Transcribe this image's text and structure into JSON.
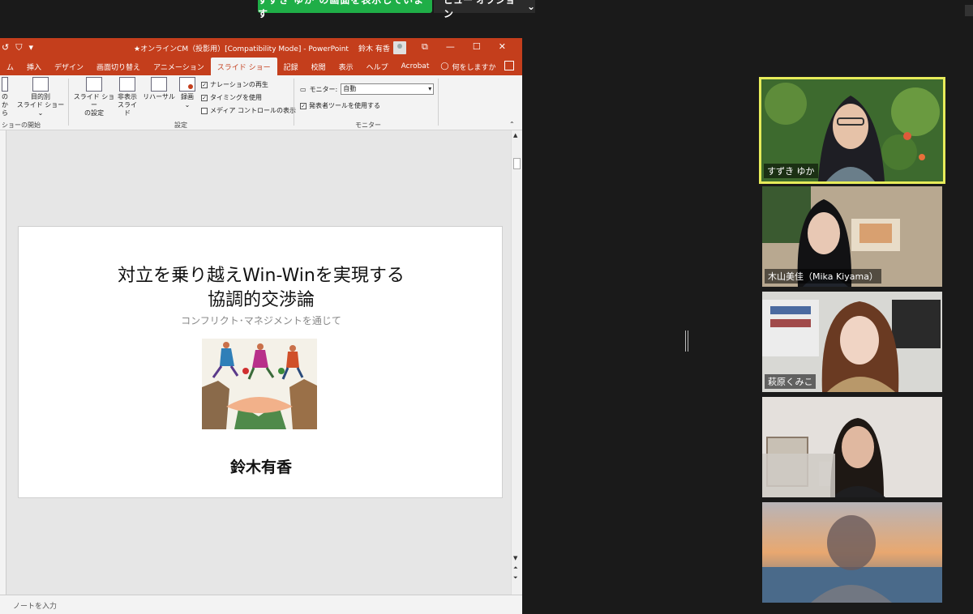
{
  "zoom": {
    "share_banner": "すずき ゆか の画面を表示しています",
    "view_options": "ビュー オプション",
    "view_options_caret": "⌄",
    "participants": [
      {
        "name": "すずき ゆか",
        "active": true
      },
      {
        "name": "木山美佳（Mika Kiyama）",
        "active": false
      },
      {
        "name": "萩原くみこ",
        "active": false
      },
      {
        "name": "",
        "active": false
      },
      {
        "name": "",
        "active": false
      }
    ],
    "colors": {
      "share_green": "#1fae47",
      "active_border": "#e7ec5a",
      "background": "#1a1a1a"
    }
  },
  "ppt": {
    "title": "★オンラインCM（投影用）[Compatibility Mode] - PowerPoint",
    "user": "鈴木 有香",
    "window_controls": [
      "⧉",
      "—",
      "☐",
      "✕"
    ],
    "qat": [
      "↺",
      "⛉",
      "▾"
    ],
    "tabs": [
      "ム",
      "挿入",
      "デザイン",
      "画面切り替え",
      "アニメーション",
      "スライド ショー",
      "記録",
      "校閲",
      "表示",
      "ヘルプ",
      "Acrobat"
    ],
    "active_tab": "スライド ショー",
    "tell_me": "何をしますか",
    "ribbon": {
      "partial_left": [
        "の",
        "から"
      ],
      "custom_show": [
        "目的別",
        "スライド ショー ⌄"
      ],
      "group_start": "ショーの開始",
      "setup_show": [
        "スライド ショー",
        "の設定"
      ],
      "hide_slide": [
        "非表示",
        "スライド"
      ],
      "rehearse": "リハーサル",
      "record": [
        "録画",
        "⌄"
      ],
      "checks": [
        {
          "label": "ナレーションの再生",
          "checked": true
        },
        {
          "label": "タイミングを使用",
          "checked": true
        },
        {
          "label": "メディア コントロールの表示",
          "checked": false
        }
      ],
      "group_setup": "設定",
      "monitor_label": "モニター:",
      "monitor_value": "自動",
      "presenter_view": {
        "label": "発表者ツールを使用する",
        "checked": true
      },
      "group_monitor": "モニター"
    },
    "slide": {
      "title_line1": "対立を乗り越えWin-Winを実現する",
      "title_line2": "協調的交渉論",
      "subtitle": "コンフリクト･マネジメントを通じて",
      "author": "鈴木有香"
    },
    "notes_placeholder": "ノートを入力",
    "colors": {
      "accent": "#c43e1c",
      "ribbon_bg": "#f3f3f3",
      "canvas": "#e6e6e6"
    }
  }
}
